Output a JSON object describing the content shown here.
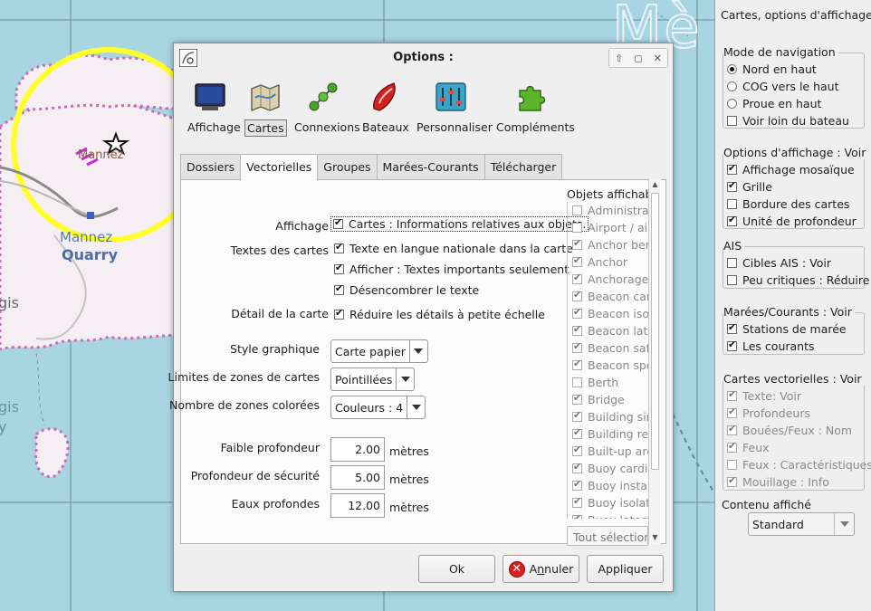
{
  "map": {
    "place_name_1": "Mannez",
    "place_name_2": "Mannez",
    "place_name_3": "Quarry",
    "big_label": "Mè",
    "edge_label_1": "gis",
    "edge_label_2": "gis",
    "edge_label_3": "y"
  },
  "dialog": {
    "title": "Options :",
    "window_buttons": {
      "up": "⇧",
      "restore": "◻",
      "close": "✕"
    },
    "categories": [
      {
        "label": "Affichage",
        "icon": "display-icon"
      },
      {
        "label": "Cartes",
        "icon": "charts-icon"
      },
      {
        "label": "Connexions",
        "icon": "connections-icon"
      },
      {
        "label": "Bateaux",
        "icon": "ships-icon"
      },
      {
        "label": "Personnaliser",
        "icon": "customize-icon"
      },
      {
        "label": "Compléments",
        "icon": "plugins-icon"
      }
    ],
    "active_category": "Cartes",
    "tabs": [
      "Dossiers",
      "Vectorielles",
      "Groupes",
      "Marées-Courants",
      "Télécharger"
    ],
    "active_tab": "Vectorielles",
    "vector": {
      "affichage_label": "Affichage",
      "affichage_option": {
        "label": "Cartes : Informations relatives aux objets.",
        "checked": true
      },
      "textes_label": "Textes des cartes",
      "textes_options": [
        {
          "label": "Texte en langue nationale dans la carte",
          "checked": true
        },
        {
          "label": "Afficher : Textes importants seulement",
          "checked": true
        },
        {
          "label": "Désencombrer le texte",
          "checked": true
        }
      ],
      "detail_label": "Détail de la carte",
      "detail_option": {
        "label": "Réduire les détails à petite échelle",
        "checked": true
      },
      "style_label": "Style graphique",
      "style_value": "Carte papier",
      "limites_label": "Limites de zones de cartes",
      "limites_value": "Pointillées",
      "zones_label": "Nombre de zones colorées",
      "zones_value": "Couleurs : 4",
      "depths": [
        {
          "label": "Faible profondeur",
          "value": "2.00",
          "unit": "mètres"
        },
        {
          "label": "Profondeur de sécurité",
          "value": "5.00",
          "unit": "mètres"
        },
        {
          "label": "Eaux profondes",
          "value": "12.00",
          "unit": "mètres"
        }
      ]
    },
    "objects": {
      "title": "Objets affichables",
      "items": [
        {
          "label": "Administration area",
          "checked": false
        },
        {
          "label": "Airport / airfield",
          "checked": false
        },
        {
          "label": "Anchor berth",
          "checked": true
        },
        {
          "label": "Anchor",
          "checked": true
        },
        {
          "label": "Anchorage area",
          "checked": true
        },
        {
          "label": "Beacon cardinal",
          "checked": true
        },
        {
          "label": "Beacon isolated danger",
          "checked": true
        },
        {
          "label": "Beacon lateral",
          "checked": true
        },
        {
          "label": "Beacon safe water",
          "checked": true
        },
        {
          "label": "Beacon special purpose",
          "checked": true
        },
        {
          "label": "Berth",
          "checked": false
        },
        {
          "label": "Bridge",
          "checked": true
        },
        {
          "label": "Building single",
          "checked": true
        },
        {
          "label": "Building religious",
          "checked": true
        },
        {
          "label": "Built-up area",
          "checked": true
        },
        {
          "label": "Buoy cardinal",
          "checked": true
        },
        {
          "label": "Buoy installation",
          "checked": true
        },
        {
          "label": "Buoy isolated danger",
          "checked": true
        },
        {
          "label": "Buoy lateral",
          "checked": true
        }
      ],
      "select_all": "Tout sélectionner"
    },
    "buttons": {
      "ok": "Ok",
      "cancel_pre": "A",
      "cancel_mnemonic": "n",
      "cancel_post": "nuler",
      "apply": "Appliquer"
    }
  },
  "side": {
    "title": "Cartes, options d'affichage",
    "navigation": {
      "title": "Mode de navigation",
      "options": [
        {
          "label": "Nord en haut",
          "selected": true
        },
        {
          "label": "COG vers le haut",
          "selected": false
        },
        {
          "label": "Proue en haut",
          "selected": false
        }
      ],
      "look_ahead": {
        "label": "Voir loin du bateau",
        "checked": false
      }
    },
    "display": {
      "title": "Options d'affichage : Voir",
      "options": [
        {
          "label": "Affichage mosaïque",
          "checked": true
        },
        {
          "label": "Grille",
          "checked": true
        },
        {
          "label": "Bordure des cartes",
          "checked": false
        },
        {
          "label": "Unité de profondeur",
          "checked": true
        }
      ]
    },
    "ais": {
      "title": "AIS",
      "options": [
        {
          "label": "Cibles AIS : Voir",
          "checked": false
        },
        {
          "label": "Peu critiques : Réduire",
          "checked": false
        }
      ]
    },
    "tides": {
      "title": "Marées/Courants : Voir",
      "options": [
        {
          "label": "Stations de marée",
          "checked": true
        },
        {
          "label": "Les courants",
          "checked": true
        }
      ]
    },
    "vector": {
      "title": "Cartes vectorielles : Voir",
      "options": [
        {
          "label": "Texte: Voir",
          "checked": true
        },
        {
          "label": "Profondeurs",
          "checked": true
        },
        {
          "label": "Bouées/Feux : Nom",
          "checked": true
        },
        {
          "label": "Feux",
          "checked": true
        },
        {
          "label": "Feux : Caractéristiques",
          "checked": false
        },
        {
          "label": "Mouillage : Info",
          "checked": true
        }
      ]
    },
    "content_label": "Contenu affiché",
    "content_value": "Standard"
  },
  "colors": {
    "water": "#a9d4e2",
    "land": "#f5eef2",
    "land_border": "#c76fb5",
    "ring": "#ffff2a",
    "cancel_red": "#d8201e"
  }
}
